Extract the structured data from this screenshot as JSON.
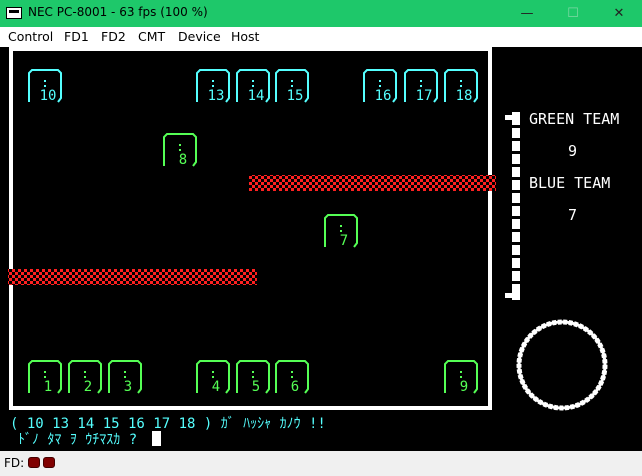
{
  "window": {
    "title": "NEC PC-8001 - 63 fps (100 %)",
    "minimize_glyph": "—",
    "maximize_glyph": "☐",
    "close_glyph": "✕"
  },
  "menu": [
    "Control",
    "FD1",
    "FD2",
    "CMT",
    "Device",
    "Host"
  ],
  "game": {
    "green_team_label": "GREEN TEAM",
    "green_team_score": "9",
    "blue_team_label": "BLUE  TEAM",
    "blue_team_score": "7",
    "blue_cabins": [
      "10",
      "13",
      "14",
      "15",
      "16",
      "17",
      "18"
    ],
    "green_cabins": [
      "8",
      "7",
      "1",
      "2",
      "3",
      "4",
      "5",
      "6",
      "9"
    ],
    "message_line1": "( 10  13  14  15  16  17  18 ) ｶﾞ ﾊｯｼｬ ｶﾉｳ !!",
    "message_line2": "ﾄﾞﾉ ﾀﾏ ｦ ｳﾁﾏｽｶ ?",
    "colors": {
      "blue_cabin": "#55ffff",
      "green_cabin": "#55ff55",
      "barrier": "#ff2222",
      "frame": "#ffffff"
    }
  },
  "status": {
    "fd_label": "FD:"
  }
}
